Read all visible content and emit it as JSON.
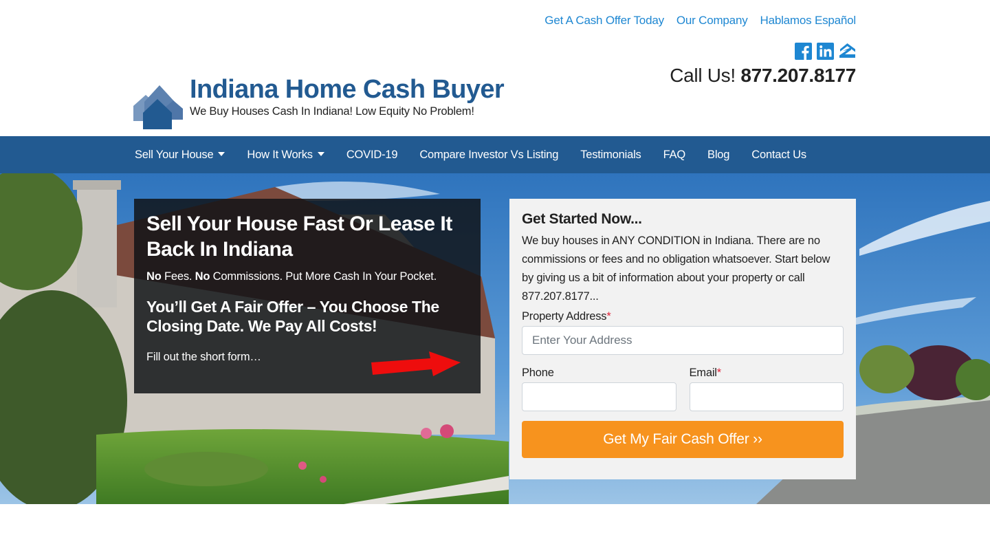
{
  "header": {
    "top_links": [
      "Get A Cash Offer Today",
      "Our Company",
      "Hablamos Español"
    ],
    "logo_title": "Indiana Home Cash Buyer",
    "logo_tagline": "We Buy Houses Cash In Indiana! Low Equity No Problem!",
    "social_icons": [
      "facebook-icon",
      "linkedin-icon",
      "zillow-icon"
    ],
    "call_label": "Call Us!",
    "phone": "877.207.8177"
  },
  "nav": {
    "items": [
      {
        "label": "Sell Your House",
        "dropdown": true
      },
      {
        "label": "How It Works",
        "dropdown": true
      },
      {
        "label": "COVID-19",
        "dropdown": false
      },
      {
        "label": "Compare Investor Vs Listing",
        "dropdown": false
      },
      {
        "label": "Testimonials",
        "dropdown": false
      },
      {
        "label": "FAQ",
        "dropdown": false
      },
      {
        "label": "Blog",
        "dropdown": false
      },
      {
        "label": "Contact Us",
        "dropdown": false
      }
    ]
  },
  "hero": {
    "title": "Sell Your House Fast Or Lease It Back In Indiana",
    "sub_no1": "No",
    "sub_text1": " Fees. ",
    "sub_no2": "No",
    "sub_text2": " Commissions. Put More Cash In Your Pocket.",
    "subtitle2": "You’ll Get A Fair Offer – You Choose The Closing Date. We Pay All Costs!",
    "fill_text": "Fill out the short form…"
  },
  "form": {
    "title": "Get Started Now...",
    "description": "We buy houses in ANY CONDITION in Indiana. There are no commissions or fees and no obligation whatsoever. Start below by giving us a bit of information about your property or call 877.207.8177...",
    "address_label": "Property Address",
    "address_placeholder": "Enter Your Address",
    "address_value": "",
    "phone_label": "Phone",
    "phone_value": "",
    "email_label": "Email",
    "email_value": "",
    "required_mark": "*",
    "submit_label": "Get My Fair Cash Offer ››"
  },
  "colors": {
    "brand_blue": "#225a91",
    "link_blue": "#1e87d2",
    "cta_orange": "#f7931e",
    "required_red": "#e0243a"
  }
}
